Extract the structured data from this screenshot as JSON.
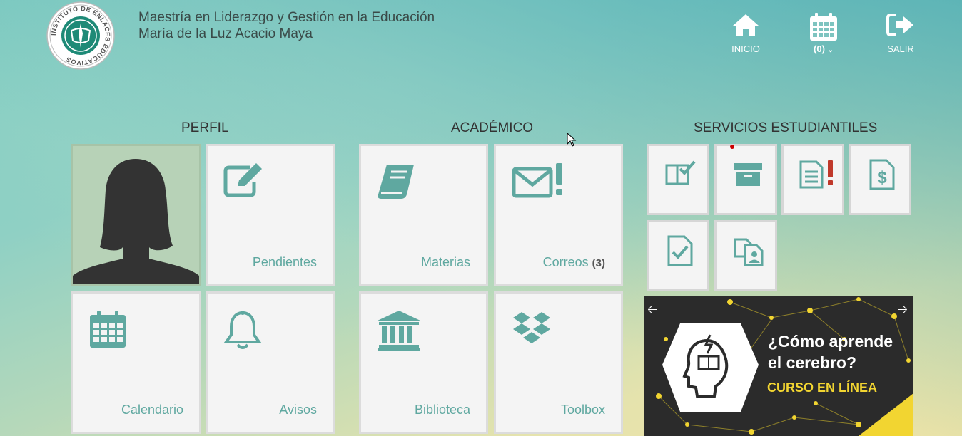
{
  "header": {
    "program": "Maestría en Liderazgo y Gestión en la Educación",
    "student": "María de la Luz Acacio Maya",
    "logo_text": "INSTITUTO DE ENLACES EDUCATIVOS"
  },
  "nav": {
    "home_label": "INICIO",
    "calendar_label": "(0)",
    "logout_label": "SALIR"
  },
  "sections": {
    "profile": "PERFIL",
    "academic": "ACADÉMICO",
    "services": "SERVICIOS ESTUDIANTILES"
  },
  "tiles": {
    "pending": "Pendientes",
    "calendar": "Calendario",
    "notices": "Avisos",
    "subjects": "Materias",
    "mail": "Correos",
    "mail_count": "(3)",
    "library": "Biblioteca",
    "toolbox": "Toolbox"
  },
  "banner": {
    "title_line1": "¿Cómo aprende",
    "title_line2": "el cerebro?",
    "subtitle": "CURSO EN LÍNEA"
  },
  "colors": {
    "accent": "#5fa8a0",
    "alert": "#c0392b",
    "highlight": "#f2d531"
  }
}
